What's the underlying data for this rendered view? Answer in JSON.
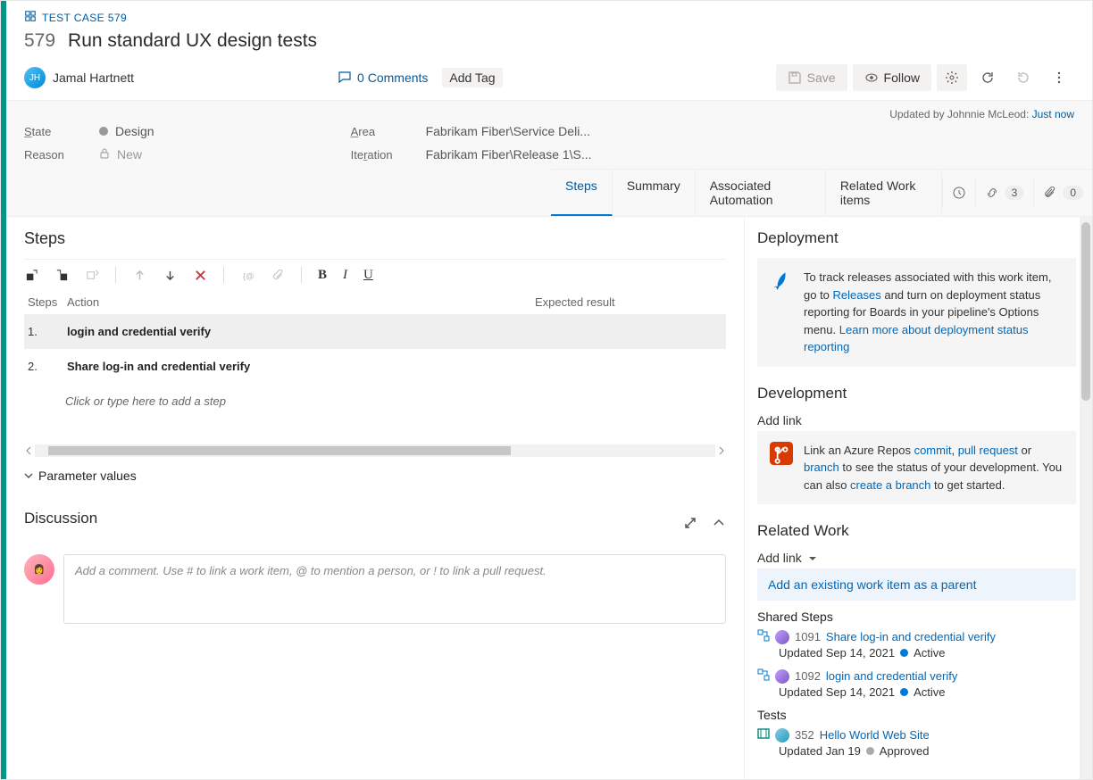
{
  "workitem": {
    "type_label": "TEST CASE 579",
    "id": "579",
    "title": "Run standard UX design tests",
    "assignee": "Jamal Hartnett",
    "comments_label": "0 Comments",
    "add_tag_label": "Add Tag"
  },
  "toolbar": {
    "save": "Save",
    "follow": "Follow"
  },
  "updated": {
    "prefix": "Updated by Johnnie McLeod:",
    "when": "Just now"
  },
  "fields": {
    "state_label": "State",
    "state_value": "Design",
    "reason_label": "Reason",
    "reason_value": "New",
    "area_label": "Area",
    "area_value": "Fabrikam Fiber\\Service Deli...",
    "iter_label": "Iteration",
    "iter_value": "Fabrikam Fiber\\Release 1\\S..."
  },
  "tabs": {
    "steps": "Steps",
    "summary": "Summary",
    "assoc": "Associated Automation",
    "related": "Related Work items",
    "links_count": "3",
    "attach_count": "0"
  },
  "steps_section": {
    "title": "Steps",
    "col_steps": "Steps",
    "col_action": "Action",
    "col_expected": "Expected result",
    "rows": [
      {
        "n": "1.",
        "action": "login and credential verify"
      },
      {
        "n": "2.",
        "action": "Share log-in and credential verify"
      }
    ],
    "placeholder": "Click or type here to add a step",
    "param_label": "Parameter values"
  },
  "discussion": {
    "title": "Discussion",
    "placeholder": "Add a comment. Use # to link a work item, @ to mention a person, or ! to link a pull request."
  },
  "deployment": {
    "title": "Deployment",
    "text_pre": "To track releases associated with this work item, go to ",
    "link1": "Releases",
    "text_mid": " and turn on deployment status reporting for Boards in your pipeline's Options menu. ",
    "link2": "Learn more about deployment status reporting"
  },
  "development": {
    "title": "Development",
    "addlink": "Add link",
    "text1": "Link an Azure Repos ",
    "l_commit": "commit",
    "l_pr": "pull request",
    "text2": " or ",
    "l_branch": "branch",
    "text3": " to see the status of your development. You can also ",
    "l_create": "create a branch",
    "text4": " to get started."
  },
  "related": {
    "title": "Related Work",
    "addlink": "Add link",
    "suggest": "Add an existing work item as a parent",
    "shared_title": "Shared Steps",
    "tests_title": "Tests",
    "items": [
      {
        "id": "1091",
        "title": "Share log-in and credential verify",
        "sub": "Updated Sep 14, 2021",
        "status": "Active",
        "dot": "blue"
      },
      {
        "id": "1092",
        "title": "login and credential verify",
        "sub": "Updated Sep 14, 2021",
        "status": "Active",
        "dot": "blue"
      }
    ],
    "tests": [
      {
        "id": "352",
        "title": "Hello World Web Site",
        "sub": "Updated Jan 19",
        "status": "Approved",
        "dot": "grey"
      }
    ]
  }
}
